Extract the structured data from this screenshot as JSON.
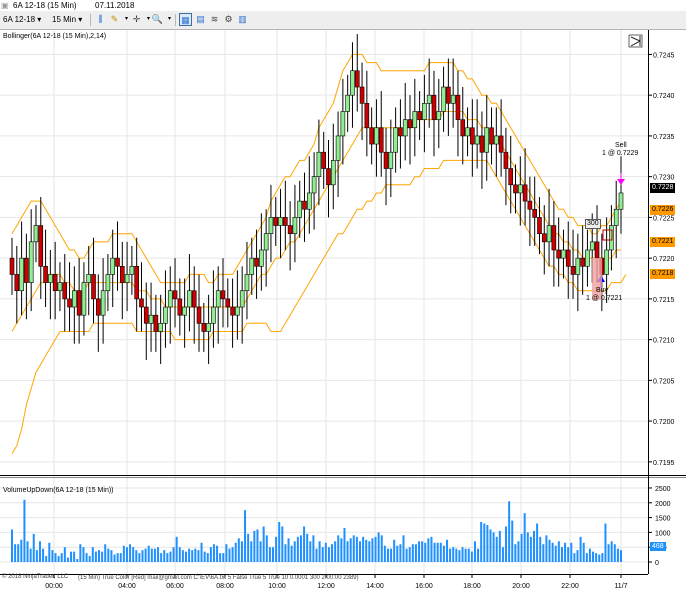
{
  "window": {
    "instrument_title": "6A 12-18 (15 Min)",
    "date": "07.11.2018"
  },
  "toolbar": {
    "instrument": "6A 12-18",
    "interval": "15 Min"
  },
  "indicators": {
    "bollinger_label": "Bollinger(6A 12-18 (15 Min),2,14)",
    "volume_label": "VolumeUpDown(6A 12-18 (15 Min))",
    "strategy_footer": "© 2018 NinjaTrader, LLC",
    "strategy_footer_params": "(15 Min) True Color [Red] mail@gmail.com C:\\EV\\6A.txt 5 False True 5 True 10 0.0001 300 2.00:00 2389)"
  },
  "price_badges": {
    "last": "0.7228",
    "upper_band": "0.7226",
    "middle_band": "0.7221",
    "lower_band": "0.7218"
  },
  "trades": {
    "sell_label": "Sell",
    "sell_detail": "1 @ 0.7229",
    "buy_label": "Buy",
    "buy_detail": "1 @ 0.7221",
    "quantity_box": "300"
  },
  "colors": {
    "up_candle": "#90ee90",
    "down_candle": "#cc0000",
    "bollinger": "#ffa500",
    "volume": "#1e90ff",
    "last_badge": "#000000",
    "band_badge": "#ff9900"
  },
  "chart_data": [
    {
      "type": "candlestick",
      "ylim": [
        0.7194,
        0.7248
      ],
      "y_ticks": [
        "0.7245",
        "0.7240",
        "0.7235",
        "0.7230",
        "0.7225",
        "0.7220",
        "0.7215",
        "0.7210",
        "0.7205",
        "0.7200",
        "0.7195"
      ],
      "x_ticks": [
        "00:00",
        "04:00",
        "06:00",
        "08:00",
        "10:00",
        "12:00",
        "14:00",
        "16:00",
        "18:00",
        "20:00",
        "22:00",
        "11/7"
      ],
      "close": [
        0.7218,
        0.7216,
        0.722,
        0.7217,
        0.7222,
        0.7224,
        0.7219,
        0.7217,
        0.7218,
        0.7216,
        0.7217,
        0.7215,
        0.7214,
        0.7216,
        0.7213,
        0.7217,
        0.7218,
        0.7215,
        0.7213,
        0.7216,
        0.7218,
        0.722,
        0.7219,
        0.7217,
        0.7218,
        0.7219,
        0.7215,
        0.7214,
        0.7212,
        0.7213,
        0.7211,
        0.7212,
        0.7214,
        0.7216,
        0.7215,
        0.7213,
        0.7214,
        0.7216,
        0.7214,
        0.7212,
        0.7211,
        0.7212,
        0.7214,
        0.7216,
        0.7215,
        0.7214,
        0.7213,
        0.7214,
        0.7216,
        0.7218,
        0.722,
        0.7219,
        0.7221,
        0.7223,
        0.7225,
        0.7224,
        0.7225,
        0.7224,
        0.7223,
        0.7225,
        0.7227,
        0.7226,
        0.7228,
        0.723,
        0.7233,
        0.7231,
        0.7229,
        0.7232,
        0.7235,
        0.7238,
        0.724,
        0.7243,
        0.7241,
        0.7239,
        0.7236,
        0.7234,
        0.7236,
        0.7233,
        0.7231,
        0.7233,
        0.7236,
        0.7235,
        0.7237,
        0.7236,
        0.7238,
        0.7237,
        0.7239,
        0.724,
        0.7237,
        0.7238,
        0.7241,
        0.7239,
        0.724,
        0.7237,
        0.7235,
        0.7236,
        0.7234,
        0.7235,
        0.7233,
        0.7236,
        0.7234,
        0.7235,
        0.7233,
        0.7231,
        0.7229,
        0.7228,
        0.7229,
        0.7227,
        0.7226,
        0.7225,
        0.7223,
        0.7222,
        0.7224,
        0.7221,
        0.722,
        0.7221,
        0.7219,
        0.7218,
        0.722,
        0.7219,
        0.7221,
        0.7222,
        0.722,
        0.7218,
        0.7221,
        0.7224,
        0.7226,
        0.7228
      ],
      "series": [
        {
          "name": "Bollinger upper",
          "values": [
            0.7223,
            0.7224,
            0.7225,
            0.7226,
            0.7227,
            0.7227,
            0.7227,
            0.7226,
            0.7225,
            0.7224,
            0.7223,
            0.7222,
            0.7221,
            0.7221,
            0.722,
            0.722,
            0.7221,
            0.7222,
            0.7222,
            0.7222,
            0.7222,
            0.7223,
            0.7223,
            0.7223,
            0.7223,
            0.7223,
            0.7222,
            0.7221,
            0.722,
            0.7219,
            0.7218,
            0.7217,
            0.7217,
            0.7217,
            0.7217,
            0.7217,
            0.7217,
            0.7218,
            0.7218,
            0.7218,
            0.7218,
            0.7217,
            0.7217,
            0.7218,
            0.7218,
            0.7218,
            0.7218,
            0.7219,
            0.722,
            0.7221,
            0.7222,
            0.7223,
            0.7224,
            0.7225,
            0.7227,
            0.7228,
            0.7229,
            0.723,
            0.723,
            0.7231,
            0.7232,
            0.7232,
            0.7233,
            0.7234,
            0.7236,
            0.7237,
            0.7238,
            0.7239,
            0.7241,
            0.7243,
            0.7244,
            0.7245,
            0.7245,
            0.7245,
            0.7244,
            0.7244,
            0.7244,
            0.7243,
            0.7243,
            0.7243,
            0.7243,
            0.7243,
            0.7243,
            0.7243,
            0.7243,
            0.7243,
            0.7243,
            0.7244,
            0.7244,
            0.7244,
            0.7244,
            0.7244,
            0.7244,
            0.7243,
            0.7243,
            0.7242,
            0.7242,
            0.7241,
            0.724,
            0.724,
            0.7239,
            0.7239,
            0.7238,
            0.7237,
            0.7236,
            0.7235,
            0.7234,
            0.7233,
            0.7232,
            0.7231,
            0.723,
            0.7229,
            0.7228,
            0.7227,
            0.7226,
            0.7226,
            0.7225,
            0.7225,
            0.7224,
            0.7224,
            0.7224,
            0.7223,
            0.7223,
            0.7224,
            0.7224,
            0.7225,
            0.7226,
            0.7227
          ]
        },
        {
          "name": "Bollinger middle",
          "values": [
            0.7211,
            0.7212,
            0.7213,
            0.7214,
            0.7215,
            0.7216,
            0.7217,
            0.7217,
            0.7218,
            0.7218,
            0.7218,
            0.7217,
            0.7217,
            0.7216,
            0.7216,
            0.7216,
            0.7217,
            0.7217,
            0.7217,
            0.7217,
            0.7217,
            0.7217,
            0.7217,
            0.7217,
            0.7217,
            0.7217,
            0.7216,
            0.7216,
            0.7216,
            0.7215,
            0.7215,
            0.7215,
            0.7214,
            0.7214,
            0.7214,
            0.7214,
            0.7214,
            0.7214,
            0.7214,
            0.7214,
            0.7214,
            0.7214,
            0.7214,
            0.7214,
            0.7214,
            0.7214,
            0.7214,
            0.7214,
            0.7214,
            0.7215,
            0.7216,
            0.7217,
            0.7218,
            0.7218,
            0.7219,
            0.722,
            0.722,
            0.7221,
            0.7222,
            0.7222,
            0.7223,
            0.7224,
            0.7225,
            0.7226,
            0.7227,
            0.7228,
            0.7229,
            0.723,
            0.7231,
            0.7232,
            0.7233,
            0.7234,
            0.7235,
            0.7236,
            0.7236,
            0.7236,
            0.7236,
            0.7236,
            0.7236,
            0.7236,
            0.7236,
            0.7236,
            0.7236,
            0.7236,
            0.7237,
            0.7237,
            0.7237,
            0.7237,
            0.7237,
            0.7237,
            0.7238,
            0.7238,
            0.7238,
            0.7238,
            0.7238,
            0.7237,
            0.7237,
            0.7237,
            0.7236,
            0.7236,
            0.7235,
            0.7235,
            0.7234,
            0.7233,
            0.7232,
            0.7231,
            0.723,
            0.7229,
            0.7228,
            0.7227,
            0.7226,
            0.7225,
            0.7224,
            0.7223,
            0.7223,
            0.7222,
            0.7222,
            0.7221,
            0.7221,
            0.722,
            0.722,
            0.722,
            0.722,
            0.722,
            0.722,
            0.722,
            0.7221,
            0.7221
          ]
        },
        {
          "name": "Bollinger lower",
          "values": [
            0.7196,
            0.7197,
            0.7199,
            0.7202,
            0.7204,
            0.7206,
            0.7207,
            0.7208,
            0.7209,
            0.721,
            0.7211,
            0.7211,
            0.7211,
            0.7211,
            0.7211,
            0.7211,
            0.7211,
            0.7212,
            0.7212,
            0.7212,
            0.7212,
            0.7212,
            0.7212,
            0.7212,
            0.7212,
            0.7212,
            0.7211,
            0.7211,
            0.7211,
            0.7211,
            0.7211,
            0.7211,
            0.7211,
            0.7211,
            0.721,
            0.721,
            0.721,
            0.721,
            0.721,
            0.721,
            0.721,
            0.721,
            0.7211,
            0.7211,
            0.7211,
            0.7211,
            0.7211,
            0.7211,
            0.7211,
            0.7212,
            0.7212,
            0.7212,
            0.7212,
            0.7212,
            0.7211,
            0.7211,
            0.7211,
            0.7212,
            0.7213,
            0.7214,
            0.7215,
            0.7216,
            0.7217,
            0.7218,
            0.7219,
            0.722,
            0.7221,
            0.7222,
            0.7223,
            0.7223,
            0.7224,
            0.7225,
            0.7226,
            0.7226,
            0.7227,
            0.7227,
            0.7228,
            0.7228,
            0.7229,
            0.7229,
            0.7229,
            0.7229,
            0.7229,
            0.7229,
            0.723,
            0.723,
            0.7231,
            0.7231,
            0.7231,
            0.7231,
            0.7232,
            0.7232,
            0.7232,
            0.7232,
            0.7232,
            0.7232,
            0.7232,
            0.7232,
            0.7232,
            0.7232,
            0.7231,
            0.723,
            0.7229,
            0.7228,
            0.7227,
            0.7226,
            0.7225,
            0.7224,
            0.7223,
            0.7222,
            0.7221,
            0.722,
            0.7219,
            0.7219,
            0.7218,
            0.7218,
            0.7217,
            0.7217,
            0.7216,
            0.7216,
            0.7216,
            0.7216,
            0.7216,
            0.7216,
            0.7216,
            0.7217,
            0.7217,
            0.7217,
            0.7218
          ]
        }
      ]
    },
    {
      "type": "bar",
      "ylim": [
        0,
        2600
      ],
      "y_ticks": [
        "2500",
        "2000",
        "1500",
        "1000",
        "500",
        "0"
      ],
      "last_value": "468",
      "values": [
        1100,
        600,
        600,
        750,
        2100,
        700,
        450,
        950,
        400,
        700,
        450,
        200,
        650,
        400,
        300,
        200,
        300,
        500,
        150,
        350,
        350,
        100,
        600,
        500,
        300,
        200,
        500,
        350,
        400,
        350,
        600,
        450,
        400,
        250,
        300,
        300,
        550,
        500,
        600,
        500,
        400,
        300,
        400,
        450,
        550,
        450,
        450,
        500,
        300,
        400,
        300,
        350,
        500,
        850,
        500,
        400,
        350,
        450,
        400,
        450,
        400,
        650,
        350,
        300,
        500,
        600,
        550,
        300,
        300,
        600,
        450,
        500,
        650,
        800,
        700,
        1750,
        950,
        700,
        1050,
        1100,
        700,
        1200,
        900,
        500,
        500,
        850,
        1350,
        1200,
        600,
        800,
        550,
        700,
        850,
        900,
        1200,
        950,
        700,
        900,
        450,
        700,
        500,
        650,
        500,
        600,
        700,
        900,
        800,
        1150,
        700,
        800,
        900,
        850,
        700,
        850,
        750,
        700,
        800,
        850,
        1000,
        900,
        550,
        450,
        450,
        750,
        550,
        600,
        900,
        450,
        500,
        600,
        600,
        700,
        700,
        650,
        800,
        850,
        650,
        650,
        650,
        550,
        750,
        450,
        500,
        450,
        400,
        500,
        450,
        450,
        350,
        700,
        450,
        1350,
        1300,
        1250,
        1100,
        1000,
        850,
        1050,
        500,
        1200,
        2050,
        1400,
        600,
        700,
        950,
        1650,
        1000,
        850,
        1050,
        1300,
        850,
        600,
        900,
        750,
        650,
        550,
        700,
        500,
        650,
        500,
        650,
        300,
        400,
        850,
        650,
        300,
        450,
        350,
        300,
        250,
        300,
        1300,
        600,
        700,
        600,
        450,
        400
      ]
    }
  ]
}
